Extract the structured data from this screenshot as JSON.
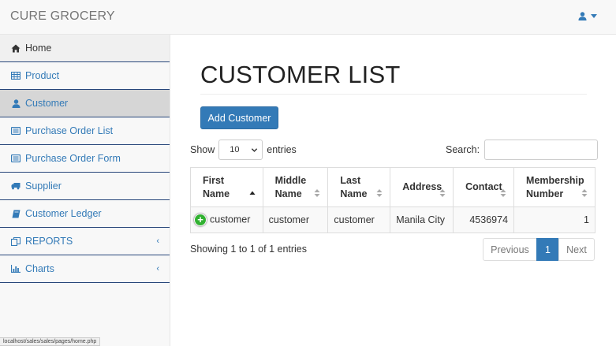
{
  "app": {
    "brand": "CURE GROCERY"
  },
  "sidebar": {
    "items": [
      {
        "label": "Home",
        "icon": "home-icon"
      },
      {
        "label": "Product",
        "icon": "table-icon"
      },
      {
        "label": "Customer",
        "icon": "user-icon",
        "active": true
      },
      {
        "label": "Purchase Order List",
        "icon": "list-alt-icon"
      },
      {
        "label": "Purchase Order Form",
        "icon": "list-alt-icon"
      },
      {
        "label": "Supplier",
        "icon": "truck-icon"
      },
      {
        "label": "Customer Ledger",
        "icon": "book-icon"
      },
      {
        "label": "REPORTS",
        "icon": "copy-icon",
        "arrow": "‹"
      },
      {
        "label": "Charts",
        "icon": "bar-chart-icon",
        "arrow": "‹"
      }
    ]
  },
  "status_url": "localhost/sales/sales/pages/home.php",
  "main": {
    "title": "CUSTOMER LIST",
    "add_button": "Add Customer",
    "length": {
      "prefix": "Show",
      "value": "10",
      "suffix": "entries"
    },
    "search_label": "Search:",
    "table": {
      "headers": [
        [
          "First",
          "Name"
        ],
        [
          "Middle",
          "Name"
        ],
        [
          "Last",
          "Name"
        ],
        [
          "Address",
          ""
        ],
        [
          "Contact",
          ""
        ],
        [
          "Membership",
          "Number"
        ]
      ],
      "rows": [
        [
          "customer",
          "customer",
          "customer",
          "Manila City",
          "4536974",
          "1"
        ]
      ]
    },
    "info": "Showing 1 to 1 of 1 entries",
    "pagination": {
      "previous": "Previous",
      "current": "1",
      "next": "Next"
    }
  },
  "colors": {
    "primary": "#337ab7",
    "nav_border": "#27467a",
    "expand_green": "#31b131"
  }
}
